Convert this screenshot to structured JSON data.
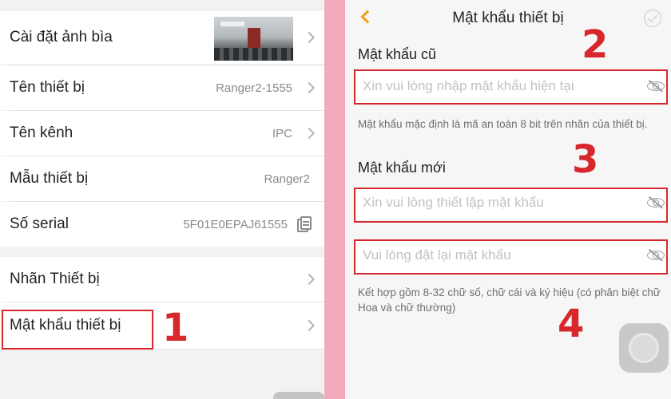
{
  "left": {
    "items": [
      {
        "label": "Cài đặt ảnh bìa",
        "value": ""
      },
      {
        "label": "Tên thiết bị",
        "value": "Ranger2-1555"
      },
      {
        "label": "Tên kênh",
        "value": "IPC"
      },
      {
        "label": "Mẫu thiết bị",
        "value": "Ranger2"
      },
      {
        "label": "Số serial",
        "value": "5F01E0EPAJ61555"
      },
      {
        "label": "Nhãn Thiết bị",
        "value": ""
      },
      {
        "label": "Mật khẩu thiết bị",
        "value": ""
      }
    ],
    "step1": "1"
  },
  "right": {
    "title": "Mật khẩu thiết bị",
    "old_label": "Mật khẩu cũ",
    "old_placeholder": "Xin vui lòng nhập mật khẩu hiện tại",
    "old_hint": "Mật khẩu mặc định là mã an toàn 8 bit trên nhãn của thiết bị.",
    "new_label": "Mật khẩu mới",
    "new_placeholder": "Xin vui lòng thiết lập mật khẩu",
    "confirm_placeholder": "Vui lòng đặt lại mật khẩu",
    "new_hint": "Kết hợp gồm 8-32 chữ số, chữ cái và ký hiệu (có phân biệt chữ Hoa và chữ thường)",
    "step2": "2",
    "step3": "3",
    "step4": "4"
  },
  "colors": {
    "accent": "#f0a01a",
    "annotation": "#d7262c",
    "divider": "#f4a9bd"
  }
}
